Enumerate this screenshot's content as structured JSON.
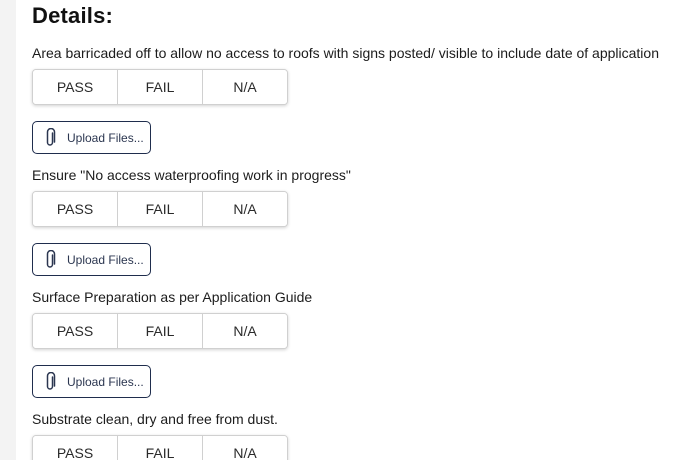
{
  "section": {
    "title": "Details:"
  },
  "choice_options": [
    "PASS",
    "FAIL",
    "N/A"
  ],
  "upload_label": "Upload Files...",
  "items": [
    {
      "label": "Area barricaded off to allow no access to roofs with signs posted/ visible to include date of application"
    },
    {
      "label": "Ensure \"No access waterproofing work in progress\""
    },
    {
      "label": "Surface Preparation as per Application Guide"
    },
    {
      "label": "Substrate clean, dry and free from dust."
    }
  ],
  "icons": {
    "upload": "paperclip-icon"
  },
  "colors": {
    "upload_border": "#1f2d4d",
    "choice_border": "#d0d0d0",
    "page_background": "#f3f3f3"
  }
}
